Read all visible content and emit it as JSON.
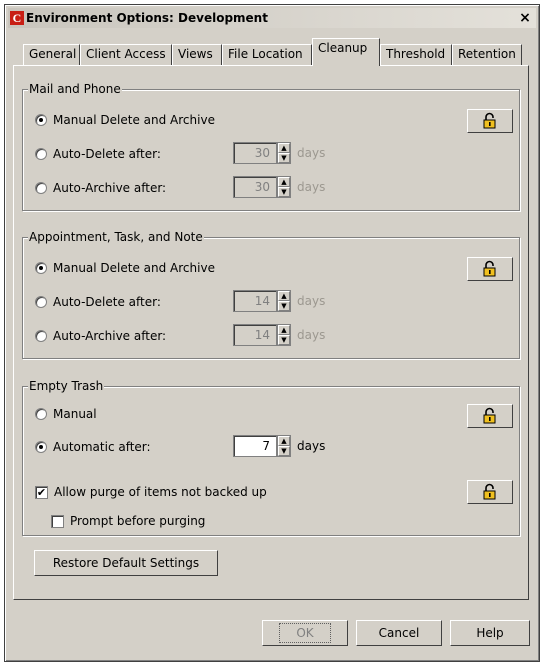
{
  "window": {
    "title": "Environment Options: Development",
    "close": "×"
  },
  "tabs": [
    "General",
    "Client Access",
    "Views",
    "File Location",
    "Cleanup",
    "Threshold",
    "Retention"
  ],
  "active_tab": "Cleanup",
  "mail": {
    "legend": "Mail and Phone",
    "manual": "Manual Delete and Archive",
    "auto_delete": "Auto-Delete after:",
    "auto_delete_value": "30",
    "auto_archive": "Auto-Archive after:",
    "auto_archive_value": "30",
    "unit": "days"
  },
  "appt": {
    "legend": "Appointment, Task, and Note",
    "manual": "Manual Delete and Archive",
    "auto_delete": "Auto-Delete after:",
    "auto_delete_value": "14",
    "auto_archive": "Auto-Archive after:",
    "auto_archive_value": "14",
    "unit": "days"
  },
  "trash": {
    "legend": "Empty Trash",
    "manual": "Manual",
    "automatic": "Automatic after:",
    "automatic_value": "7",
    "unit": "days",
    "allow_purge": "Allow purge of items not backed up",
    "prompt": "Prompt before purging"
  },
  "buttons": {
    "restore": "Restore Default Settings",
    "ok": "OK",
    "cancel": "Cancel",
    "help": "Help"
  }
}
